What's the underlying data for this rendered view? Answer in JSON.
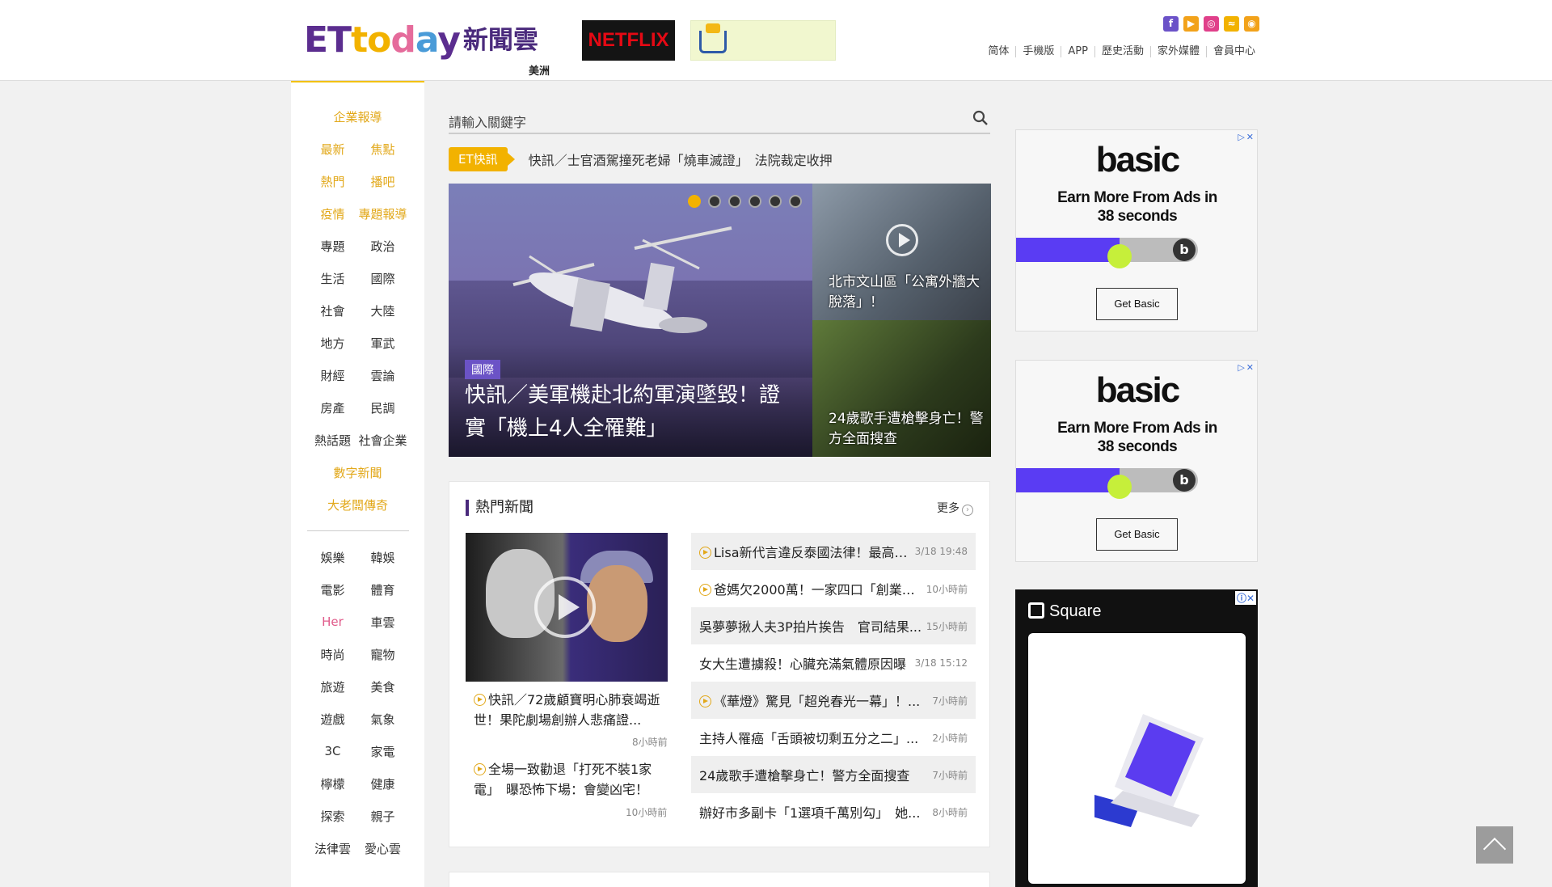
{
  "header": {
    "logo_text": "ETtoday",
    "logo_cn": "新聞雲",
    "edition": "美洲",
    "ad_netflix": "NETFLIX",
    "social_icons": [
      "facebook-icon",
      "youtube-icon",
      "instagram-icon",
      "rss-icon",
      "weibo-icon"
    ],
    "top_links": [
      "简体",
      "手機版",
      "APP",
      "歷史活動",
      "家外媒體",
      "會員中心"
    ]
  },
  "nav": {
    "group1": [
      [
        "企業報導"
      ],
      [
        "最新",
        "焦點"
      ],
      [
        "熱門",
        "播吧"
      ],
      [
        "疫情",
        "專題報導"
      ],
      [
        "專題",
        "政治"
      ],
      [
        "生活",
        "國際"
      ],
      [
        "社會",
        "大陸"
      ],
      [
        "地方",
        "軍武"
      ],
      [
        "財經",
        "雲論"
      ],
      [
        "房產",
        "民調"
      ],
      [
        "熱話題",
        "社會企業"
      ],
      [
        "數字新聞"
      ],
      [
        "大老闆傳奇"
      ]
    ],
    "group2": [
      [
        "娛樂",
        "韓娛"
      ],
      [
        "電影",
        "體育"
      ],
      [
        "Her",
        "車雲"
      ],
      [
        "時尚",
        "寵物"
      ],
      [
        "旅遊",
        "美食"
      ],
      [
        "遊戲",
        "氣象"
      ],
      [
        "3C",
        "家電"
      ],
      [
        "檸檬",
        "健康"
      ],
      [
        "探索",
        "親子"
      ],
      [
        "法律雲",
        "愛心雲"
      ]
    ]
  },
  "search": {
    "placeholder": "請輸入關鍵字"
  },
  "flash": {
    "tag": "ET快訊",
    "text": "快訊／士官酒駕撞死老婦「燒車滅證」　法院裁定收押"
  },
  "hero": {
    "category": "國際",
    "title": "快訊／美軍機赴北約軍演墜毀！證實「機上4人全罹難」",
    "slides": 6,
    "active_slide": 1
  },
  "side_stories": [
    {
      "title": "北市文山區「公寓外牆大脫落」！"
    },
    {
      "title": "24歲歌手遭槍擊身亡！警方全面搜查"
    }
  ],
  "hot_news": {
    "heading": "熱門新聞",
    "more": "更多",
    "featured": [
      {
        "title": "快訊／72歲顧寶明心肺衰竭逝世！果陀劇場創辦人悲痛證...",
        "time": "8小時前",
        "video": true
      },
      {
        "title": "全場一致勸退「打死不裝1家電」　曝恐怖下場：會變凶宅！",
        "time": "10小時前",
        "video": true
      }
    ],
    "list": [
      {
        "title": "Lisa新代言違反泰國法律！最高「...",
        "time": "3/18 19:48",
        "video": true
      },
      {
        "title": "爸媽欠2000萬！一家四口「創業賣...",
        "time": "10小時前",
        "video": true
      },
      {
        "title": "吳夢夢揪人夫3P拍片挨告　官司結果...",
        "time": "15小時前",
        "video": false
      },
      {
        "title": "女大生遭擄殺！心臟充滿氣體原因曝",
        "time": "3/18 15:12",
        "video": false
      },
      {
        "title": "《華燈》驚見「超兇春光一幕」！...",
        "time": "7小時前",
        "video": true
      },
      {
        "title": "主持人罹癌「舌頭被切剩五分之二」...",
        "time": "2小時前",
        "video": false
      },
      {
        "title": "24歲歌手遭槍擊身亡！警方全面搜查",
        "time": "7小時前",
        "video": false
      },
      {
        "title": "辦好市多副卡「1選項千萬別勾」　她...",
        "time": "8小時前",
        "video": false
      }
    ]
  },
  "ads": {
    "basic": {
      "brand": "basic",
      "line1": "Earn More From Ads in",
      "line2": "38 seconds",
      "button": "Get Basic"
    },
    "square": {
      "brand": "Square"
    }
  },
  "colors": {
    "accent": "#f2b200",
    "brand_purple": "#4a2a7c",
    "nav_yellow": "#e2a81a",
    "her_pink": "#e05a8a"
  }
}
